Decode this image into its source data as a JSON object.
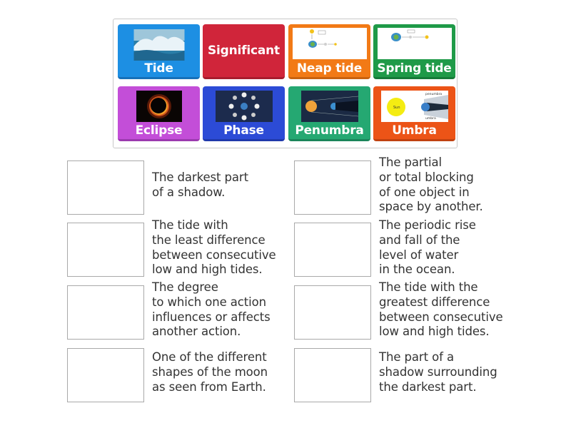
{
  "tiles": [
    {
      "label": "Tide",
      "image": "ocean-wave-photo",
      "color": "#1d8fe3"
    },
    {
      "label": "Significant",
      "image": "",
      "color": "#d0253a"
    },
    {
      "label": "Neap tide",
      "image": "neap-tide-diagram",
      "color": "#f27a16"
    },
    {
      "label": "Spring tide",
      "image": "spring-tide-diagram",
      "color": "#1f9a48"
    },
    {
      "label": "Eclipse",
      "image": "solar-eclipse-photo",
      "color": "#c34ed8"
    },
    {
      "label": "Phase",
      "image": "moon-phases-diagram",
      "color": "#2c4bd6"
    },
    {
      "label": "Penumbra",
      "image": "earth-shadow-diagram",
      "color": "#25a872"
    },
    {
      "label": "Umbra",
      "image": "umbra-penumbra-diagram",
      "color": "#ec5417"
    }
  ],
  "umbra_diagram": {
    "sun_label": "Sun",
    "penumbra_label": "penumbra",
    "umbra_label": "umbra"
  },
  "definitions": [
    "The darkest part\nof a shadow.",
    "The partial\nor total blocking\nof one object in\nspace by another.",
    "The tide with\nthe least difference\nbetween consecutive\nlow and high tides.",
    "The periodic rise\nand fall of the\nlevel of water\nin the ocean.",
    "The degree\nto which one action\ninfluences or affects\nanother action.",
    "The tide with the\ngreatest difference\nbetween consecutive\nlow and high tides.",
    "One of the different\nshapes of the moon\nas seen from Earth.",
    "The part of a\nshadow surrounding\nthe darkest part."
  ]
}
